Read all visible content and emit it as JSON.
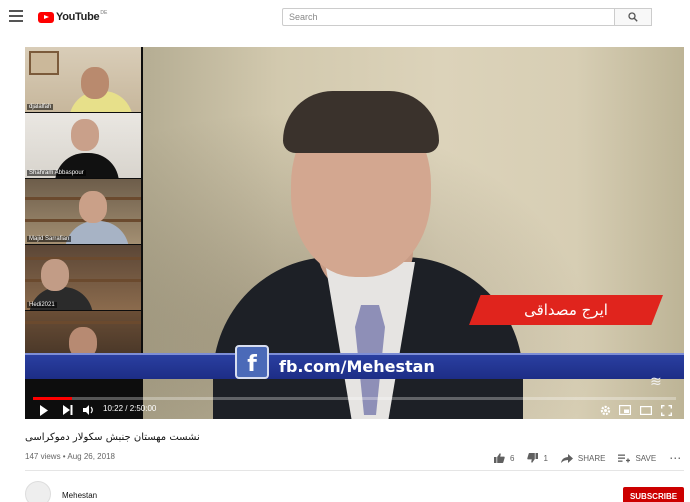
{
  "masthead": {
    "logo_text": "YouTube",
    "country_code": "DE",
    "search_placeholder": "Search"
  },
  "player": {
    "name_banner": "ایرج مصداقی",
    "social_text": "fb.com/Mehestan",
    "fb_letter": "f",
    "watermark": "≋",
    "time_display": "10:22 / 2:50:00",
    "progress": 0.061,
    "participants": [
      {
        "label": "djalalfah"
      },
      {
        "label": "Shahram Abbaspour"
      },
      {
        "label": "Majid Sarrafian"
      },
      {
        "label": "Hedi2021"
      },
      {
        "label": ""
      }
    ]
  },
  "video": {
    "title": "نشست مهستان جنبش سکولار دموکراسی",
    "meta": "147 views • Aug 26, 2018",
    "likes": "6",
    "dislikes": "1",
    "share_label": "SHARE",
    "save_label": "SAVE",
    "more_label": "⋯"
  },
  "channel": {
    "name": "Mehestan",
    "subscribe_label": "SUBSCRIBE"
  },
  "colors": {
    "brand": "#ff0000",
    "banner_red": "#e0241d",
    "fb_bar": "#1d2d86",
    "subscribe": "#cc0000"
  },
  "icons": [
    "menu-icon",
    "youtube-logo-icon",
    "search-icon",
    "play-icon",
    "next-icon",
    "volume-icon",
    "settings-icon",
    "miniplayer-icon",
    "theater-icon",
    "fullscreen-icon",
    "thumbs-up-icon",
    "thumbs-down-icon",
    "share-icon",
    "save-icon",
    "more-icon",
    "facebook-like-icon"
  ]
}
